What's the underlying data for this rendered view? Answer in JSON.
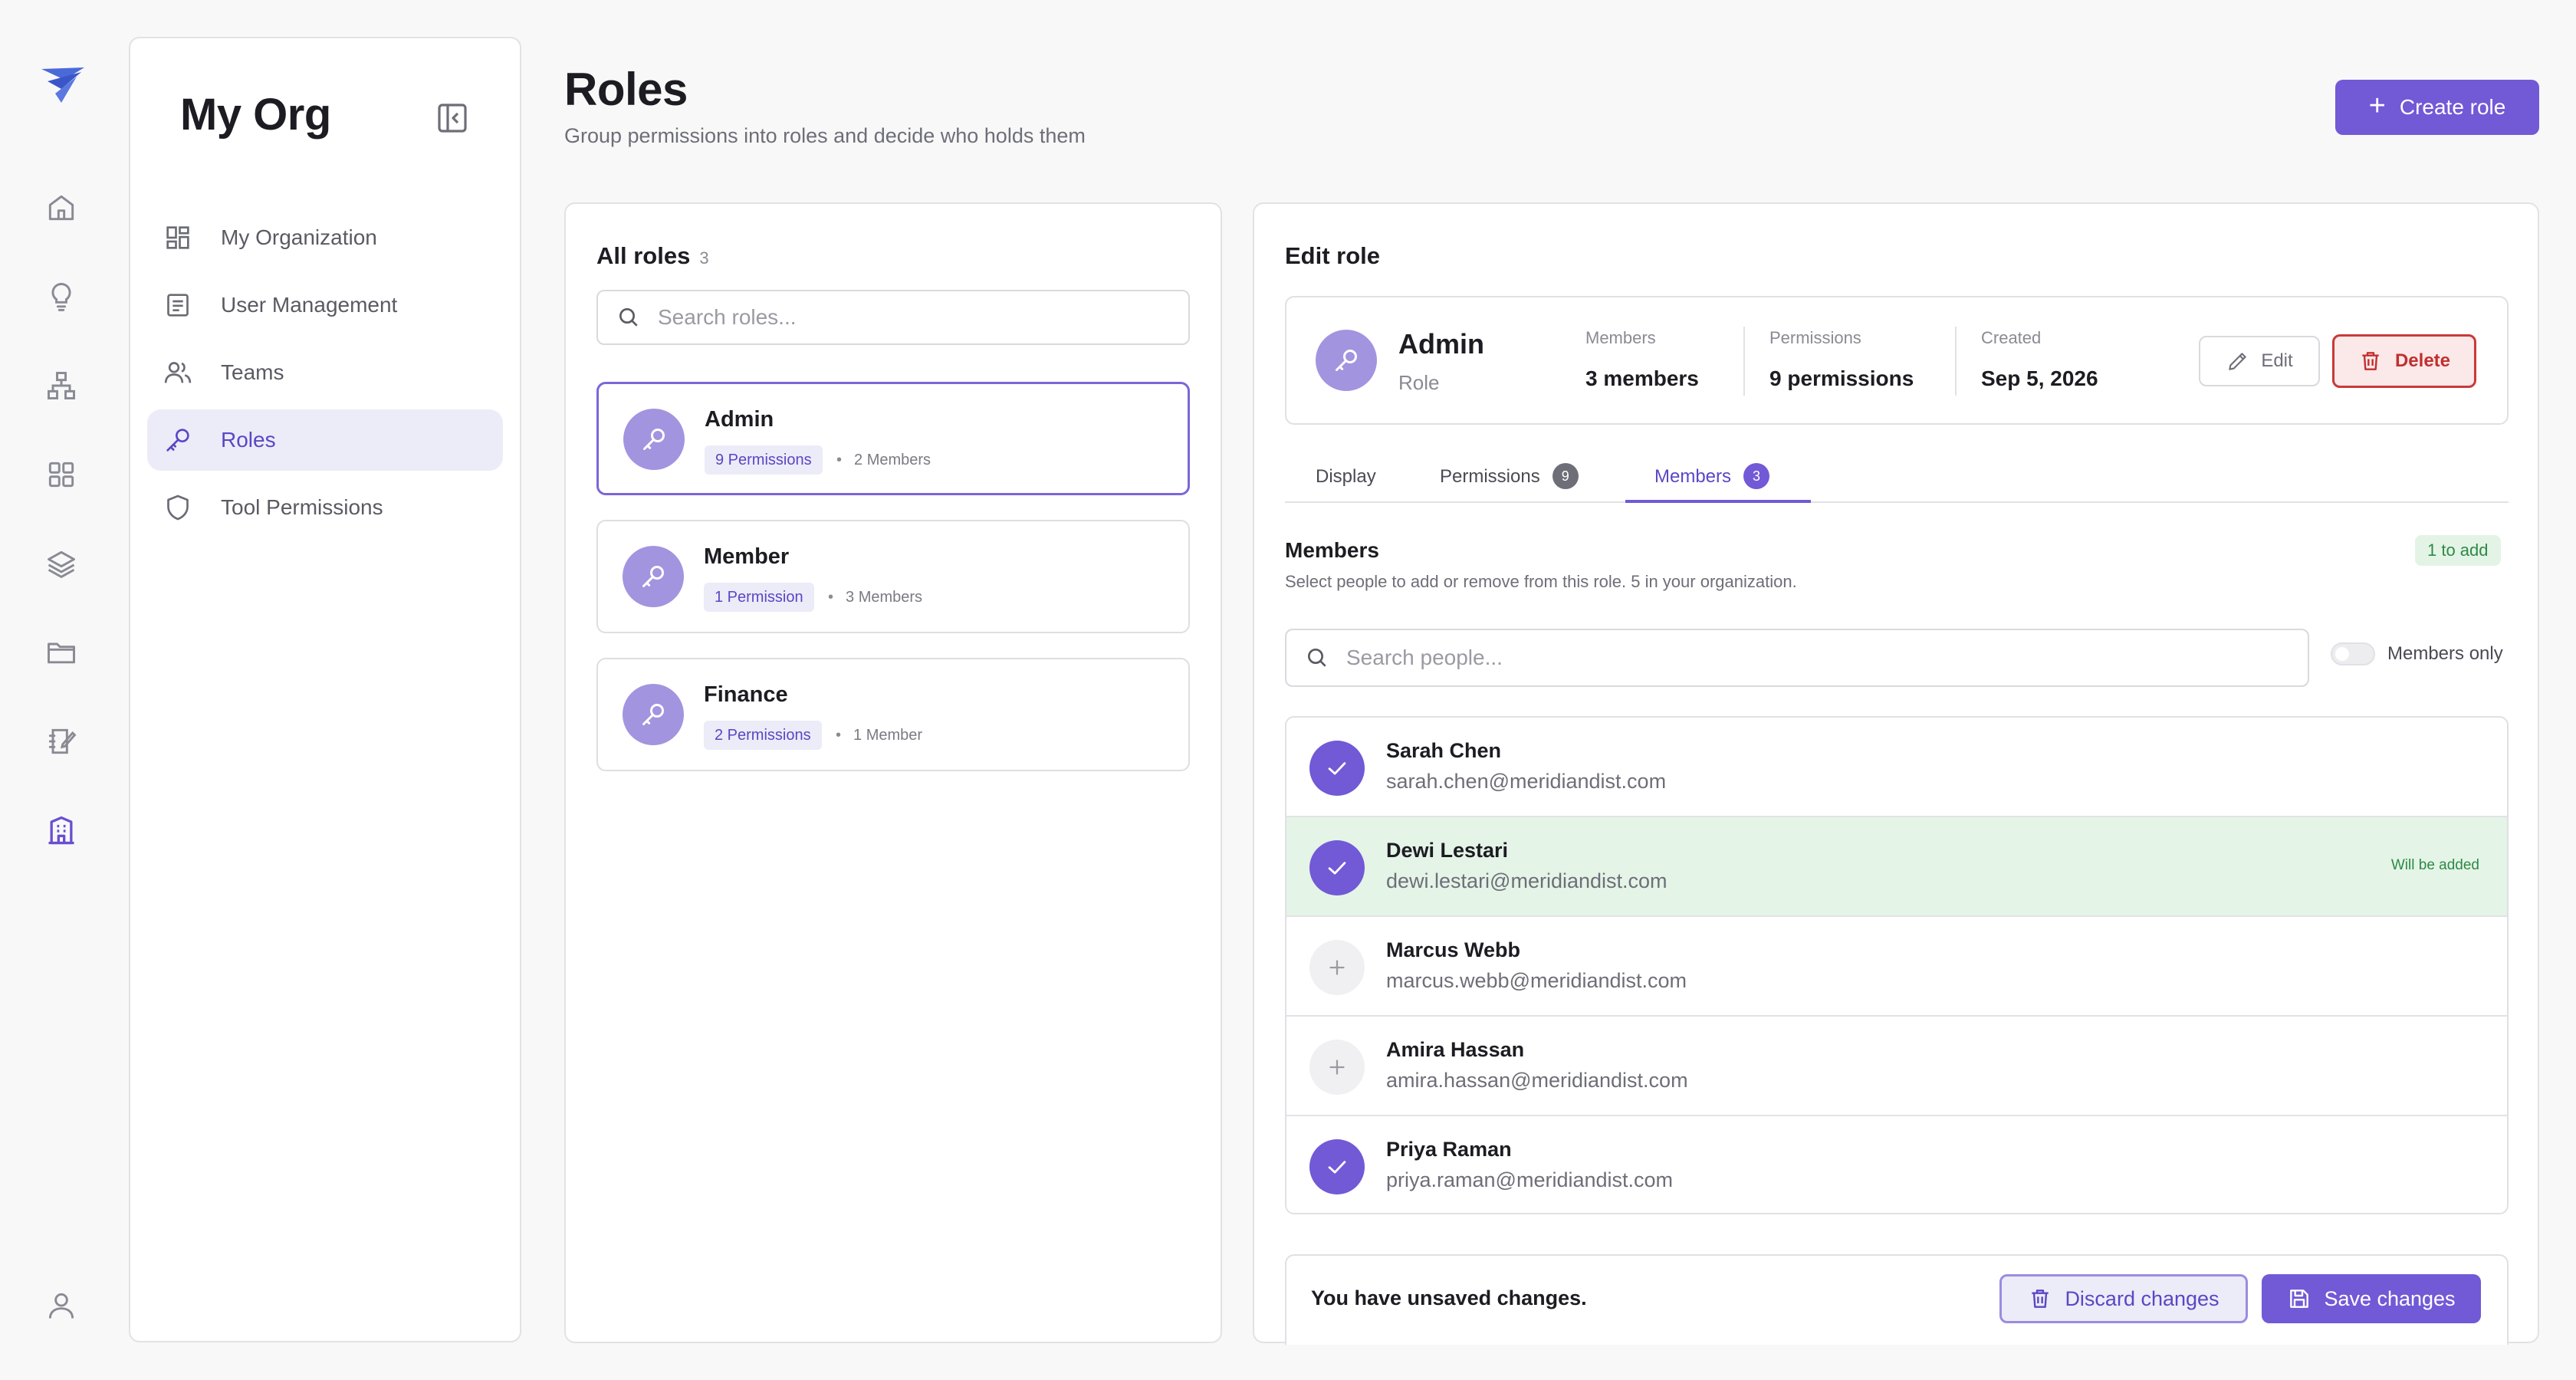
{
  "rail": {
    "items": [
      "logo",
      "home-icon",
      "lightbulb-icon",
      "org-chart-icon",
      "grid-icon",
      "layers-icon",
      "folder-icon",
      "notebook-icon",
      "building-icon",
      "user-icon"
    ],
    "active": "building-icon"
  },
  "sidebar": {
    "org_name": "My Org",
    "items": [
      {
        "label": "My Organization",
        "icon": "grid-icon"
      },
      {
        "label": "User Management",
        "icon": "document-icon"
      },
      {
        "label": "Teams",
        "icon": "users-icon"
      },
      {
        "label": "Roles",
        "icon": "key-icon",
        "active": true
      },
      {
        "label": "Tool Permissions",
        "icon": "shield-icon"
      }
    ]
  },
  "header": {
    "title": "Roles",
    "subtitle": "Group permissions into roles and decide who holds them",
    "create_label": "Create role"
  },
  "roles_panel": {
    "title": "All roles",
    "count": "3",
    "search_placeholder": "Search roles...",
    "roles": [
      {
        "name": "Admin",
        "permissions": "9 Permissions",
        "members": "2 Members",
        "selected": true
      },
      {
        "name": "Member",
        "permissions": "1 Permission",
        "members": "3 Members"
      },
      {
        "name": "Finance",
        "permissions": "2 Permissions",
        "members": "1 Member"
      }
    ]
  },
  "edit_panel": {
    "title": "Edit role",
    "role_name": "Admin",
    "role_type": "Role",
    "stats": [
      {
        "label": "Members",
        "value": "3 members"
      },
      {
        "label": "Permissions",
        "value": "9 permissions"
      },
      {
        "label": "Created",
        "value": "Sep 5, 2026"
      }
    ],
    "edit_label": "Edit",
    "delete_label": "Delete",
    "tabs": [
      {
        "label": "Display"
      },
      {
        "label": "Permissions",
        "badge": "9"
      },
      {
        "label": "Members",
        "badge": "3",
        "active": true
      }
    ],
    "members_title": "Members",
    "members_subtitle": "Select people to add or remove from this role. 5 in your organization.",
    "pending_badge": "1 to add",
    "people_search_placeholder": "Search people...",
    "members_only_label": "Members only",
    "members_only": false,
    "people": [
      {
        "name": "Sarah Chen",
        "email": "sarah.chen@meridiandist.com",
        "checked": true
      },
      {
        "name": "Dewi Lestari",
        "email": "dewi.lestari@meridiandist.com",
        "checked": true,
        "status": "Will be added"
      },
      {
        "name": "Marcus Webb",
        "email": "marcus.webb@meridiandist.com",
        "checked": false
      },
      {
        "name": "Amira Hassan",
        "email": "amira.hassan@meridiandist.com",
        "checked": false
      },
      {
        "name": "Priya Raman",
        "email": "priya.raman@meridiandist.com",
        "checked": true
      }
    ],
    "unsaved_message": "You have unsaved changes.",
    "discard_label": "Discard changes",
    "save_label": "Save changes"
  },
  "colors": {
    "accent": "#7259d6",
    "accent_light": "#ecebf8",
    "danger": "#c83a3a",
    "success_bg": "#e4f4e7",
    "success_text": "#2e8a45"
  }
}
